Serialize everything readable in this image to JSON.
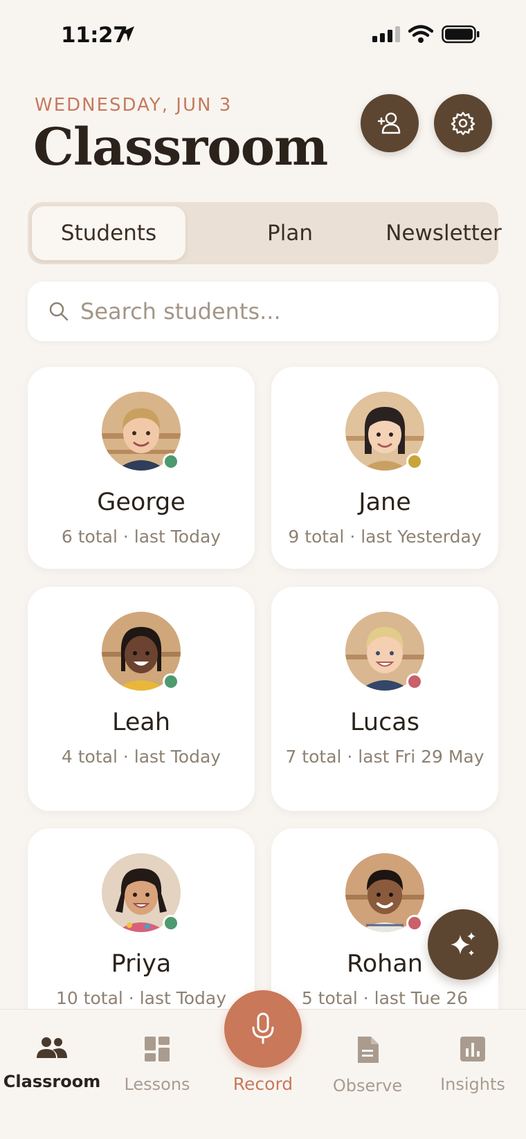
{
  "status_bar": {
    "time": "11:27"
  },
  "header": {
    "date": "WEDNESDAY, JUN 3",
    "title": "Classroom"
  },
  "segments": [
    {
      "label": "Students",
      "active": true
    },
    {
      "label": "Plan",
      "active": false
    },
    {
      "label": "Newsletter",
      "active": false
    }
  ],
  "search": {
    "placeholder": "Search students..."
  },
  "students": [
    {
      "name": "George",
      "meta": "6 total · last Today",
      "status": "green"
    },
    {
      "name": "Jane",
      "meta": "9 total · last Yesterday",
      "status": "yellow"
    },
    {
      "name": "Leah",
      "meta": "4 total · last Today",
      "status": "green"
    },
    {
      "name": "Lucas",
      "meta": "7 total · last Fri 29 May",
      "status": "red"
    },
    {
      "name": "Priya",
      "meta": "10 total · last Today",
      "status": "green"
    },
    {
      "name": "Rohan",
      "meta": "5 total · last Tue 26",
      "status": "red"
    }
  ],
  "status_colors": {
    "green": "#4c9a6e",
    "yellow": "#c9a43a",
    "red": "#c9606a"
  },
  "tabbar": {
    "classroom": "Classroom",
    "lessons": "Lessons",
    "record": "Record",
    "observe": "Observe",
    "insights": "Insights"
  },
  "colors": {
    "accent": "#c9785a",
    "brand_dark": "#5c4632",
    "background": "#f8f5f1"
  }
}
